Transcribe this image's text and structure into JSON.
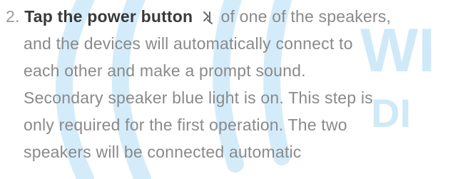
{
  "step": {
    "number": "2.",
    "bold_text": "Tap the power button",
    "icon": "power-pairing-icon",
    "lines_first_rest": "of one of the speakers,",
    "lines": [
      "and the devices will automatically connect to",
      "each other and make a prompt sound.",
      "Secondary speaker blue light is on. This step is",
      "only required for the first operation. The two",
      "speakers will be connected automatic"
    ]
  },
  "watermark": {
    "text_top": "WI",
    "text_bottom": "DI",
    "color": "#1aa7e8"
  }
}
